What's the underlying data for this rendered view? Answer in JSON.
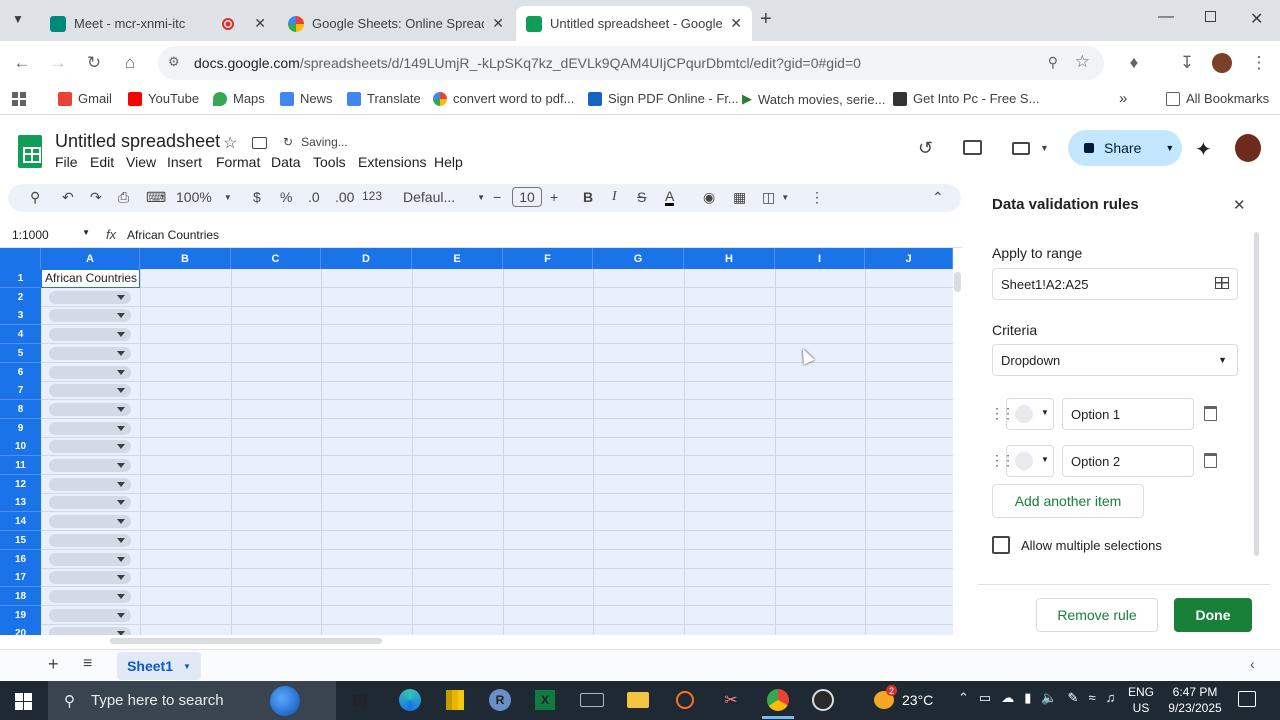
{
  "browser": {
    "tabs": [
      {
        "title": "Meet - mcr-xnmi-itc",
        "favicon_color": "#00897b",
        "recording": true
      },
      {
        "title": "Google Sheets: Online Spreadsh",
        "favicon_color": "#4285f4"
      },
      {
        "title": "Untitled spreadsheet - Google S",
        "favicon_color": "#0f9d58",
        "active": true
      }
    ],
    "url_host": "docs.google.com",
    "url_path": "/spreadsheets/d/149LUmjR_-kLpSKq7kz_dEVLk9QAM4UIjCPqurDbmtcl/edit?gid=0#gid=0",
    "bookmarks": [
      {
        "label": "Gmail",
        "color": "#ea4335"
      },
      {
        "label": "YouTube",
        "color": "#ff0000"
      },
      {
        "label": "Maps",
        "color": "#34a853"
      },
      {
        "label": "News",
        "color": "#4285f4"
      },
      {
        "label": "Translate",
        "color": "#4285f4"
      },
      {
        "label": "convert word to pdf...",
        "color": "#4285f4"
      },
      {
        "label": "Sign PDF Online - Fr...",
        "color": "#1565c0"
      },
      {
        "label": "Watch movies, serie...",
        "color": "#2e7d32"
      },
      {
        "label": "Get Into Pc - Free S...",
        "color": "#333333"
      }
    ],
    "all_bookmarks": "All Bookmarks"
  },
  "sheets": {
    "doc_title": "Untitled spreadsheet",
    "status": "Saving...",
    "menu": [
      "File",
      "Edit",
      "View",
      "Insert",
      "Format",
      "Data",
      "Tools",
      "Extensions",
      "Help"
    ],
    "share_label": "Share",
    "toolbar": {
      "zoom": "100%",
      "currency": "$",
      "percent": "%",
      "dec_down": ".0",
      "dec_up": ".00",
      "number_format": "123",
      "font": "Defaul...",
      "font_size": "10",
      "bold": "B",
      "italic": "I"
    },
    "name_box": "1:1000",
    "formula": "African Countries",
    "columns": [
      "A",
      "B",
      "C",
      "D",
      "E",
      "F",
      "G",
      "H",
      "I",
      "J"
    ],
    "rows": [
      "1",
      "2",
      "3",
      "4",
      "5",
      "6",
      "7",
      "8",
      "9",
      "10",
      "11",
      "12",
      "13",
      "14",
      "15",
      "16",
      "17",
      "18",
      "19",
      "20"
    ],
    "cell_a1": "African Countries",
    "sheet_tab": "Sheet1"
  },
  "panel": {
    "title": "Data validation rules",
    "apply_label": "Apply to range",
    "range": "Sheet1!A2:A25",
    "criteria_label": "Criteria",
    "criteria_value": "Dropdown",
    "options": [
      {
        "value": "Option 1"
      },
      {
        "value": "Option 2"
      }
    ],
    "add_item": "Add another item",
    "allow_multiple": "Allow multiple selections",
    "remove_rule": "Remove rule",
    "done": "Done"
  },
  "taskbar": {
    "search_placeholder": "Type here to search",
    "temperature": "23°C",
    "lang1": "ENG",
    "lang2": "US",
    "time": "6:47 PM",
    "date": "9/23/2025",
    "notif_count": "2"
  }
}
